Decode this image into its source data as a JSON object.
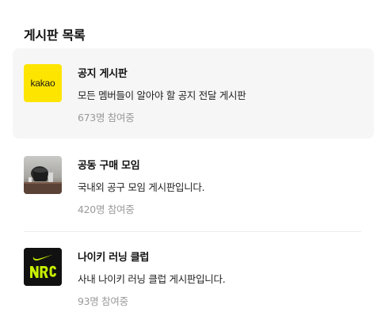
{
  "section": {
    "title": "게시판 목록"
  },
  "boards": [
    {
      "name": "공지 게시판",
      "description": "모든 멤버들이 알아야 할 공지 전달 게시판",
      "member_count": "673명 참여중",
      "thumbnail": {
        "kind": "logo",
        "text": "kakao",
        "color": "#FEE500"
      },
      "selected": true
    },
    {
      "name": "공동 구매 모임",
      "description": "국내외 공구 모임 게시판입니다.",
      "member_count": "420명 참여중",
      "thumbnail": {
        "kind": "photo",
        "subject": "product-photo"
      },
      "selected": false
    },
    {
      "name": "나이키 러닝 클럽",
      "description": "사내 나이키 러닝 클럽 게시판입니다.",
      "member_count": "93명 참여중",
      "thumbnail": {
        "kind": "logo",
        "text": "NRC",
        "color": "#C7F000"
      },
      "selected": false
    }
  ]
}
